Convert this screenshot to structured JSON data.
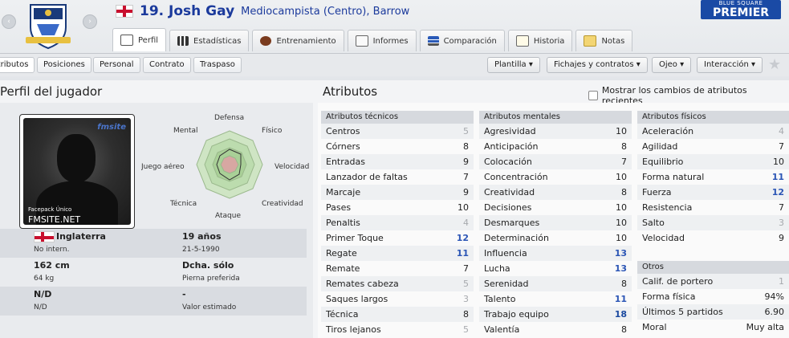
{
  "header": {
    "nav_back": "‹",
    "nav_fwd": "›",
    "player_number_name": "19. Josh Gay",
    "player_position_club": "Mediocampista (Centro), Barrow",
    "league_logo_top": "BLUE SQUARE",
    "league_logo_bottom": "PREMIER"
  },
  "tabs": [
    {
      "label": "Perfil"
    },
    {
      "label": "Estadísticas"
    },
    {
      "label": "Entrenamiento"
    },
    {
      "label": "Informes"
    },
    {
      "label": "Comparación"
    },
    {
      "label": "Historia"
    },
    {
      "label": "Notas"
    }
  ],
  "subtabs": [
    "Atributos",
    "Posiciones",
    "Personal",
    "Contrato",
    "Traspaso"
  ],
  "dropdowns": [
    "Plantilla",
    "Fichajes y contratos",
    "Ojeo",
    "Interacción"
  ],
  "profile": {
    "title": "Perfil del jugador",
    "facepack_line1": "Facepack  Único",
    "facepack_line2": "FMSITE.NET",
    "badge_text": "fmsite",
    "radar_labels": {
      "top": "Defensa",
      "top_right": "Físico",
      "right": "Velocidad",
      "bottom_right": "Creatividad",
      "bottom": "Ataque",
      "bottom_left": "Técnica",
      "left": "Juego aéreo",
      "top_left": "Mental"
    },
    "nationality": "Inglaterra",
    "intl": "No intern.",
    "age": "19 años",
    "dob": "21-5-1990",
    "height": "162 cm",
    "weight": "64 kg",
    "foot": "Dcha. sólo",
    "foot_label": "Pierna preferida",
    "value1": "N/D",
    "value1_sub": "N/D",
    "value2": "-",
    "value2_sub": "Valor estimado"
  },
  "attributes": {
    "title": "Atributos",
    "checkbox_label": "Mostrar los cambios de atributos recientes",
    "technical_header": "Atributos técnicos",
    "technical": [
      {
        "name": "Centros",
        "value": "5"
      },
      {
        "name": "Córners",
        "value": "8"
      },
      {
        "name": "Entradas",
        "value": "9"
      },
      {
        "name": "Lanzador de faltas",
        "value": "7"
      },
      {
        "name": "Marcaje",
        "value": "9"
      },
      {
        "name": "Pases",
        "value": "10"
      },
      {
        "name": "Penaltis",
        "value": "4"
      },
      {
        "name": "Primer Toque",
        "value": "12"
      },
      {
        "name": "Regate",
        "value": "11"
      },
      {
        "name": "Remate",
        "value": "7"
      },
      {
        "name": "Remates cabeza",
        "value": "5"
      },
      {
        "name": "Saques largos",
        "value": "3"
      },
      {
        "name": "Técnica",
        "value": "8"
      },
      {
        "name": "Tiros lejanos",
        "value": "5"
      }
    ],
    "mental_header": "Atributos mentales",
    "mental": [
      {
        "name": "Agresividad",
        "value": "10"
      },
      {
        "name": "Anticipación",
        "value": "8"
      },
      {
        "name": "Colocación",
        "value": "7"
      },
      {
        "name": "Concentración",
        "value": "10"
      },
      {
        "name": "Creatividad",
        "value": "8"
      },
      {
        "name": "Decisiones",
        "value": "10"
      },
      {
        "name": "Desmarques",
        "value": "10"
      },
      {
        "name": "Determinación",
        "value": "10"
      },
      {
        "name": "Influencia",
        "value": "13"
      },
      {
        "name": "Lucha",
        "value": "13"
      },
      {
        "name": "Serenidad",
        "value": "8"
      },
      {
        "name": "Talento",
        "value": "11"
      },
      {
        "name": "Trabajo equipo",
        "value": "18"
      },
      {
        "name": "Valentía",
        "value": "8"
      }
    ],
    "physical_header": "Atributos físicos",
    "physical": [
      {
        "name": "Aceleración",
        "value": "4"
      },
      {
        "name": "Agilidad",
        "value": "7"
      },
      {
        "name": "Equilibrio",
        "value": "10"
      },
      {
        "name": "Forma natural",
        "value": "11"
      },
      {
        "name": "Fuerza",
        "value": "12"
      },
      {
        "name": "Resistencia",
        "value": "7"
      },
      {
        "name": "Salto",
        "value": "3"
      },
      {
        "name": "Velocidad",
        "value": "9"
      }
    ],
    "other_header": "Otros",
    "other": [
      {
        "name": "Calif. de portero",
        "value": "1"
      },
      {
        "name": "Forma física",
        "value": "94%"
      },
      {
        "name": "Últimos 5 partidos",
        "value": "6.90"
      },
      {
        "name": "Moral",
        "value": "Muy alta"
      }
    ]
  },
  "colors": {
    "name_blue": "#1b3a9c",
    "value_high": "#2b55b5",
    "value_low": "#a6a9ad",
    "radar_fill": "#9ec98a"
  }
}
